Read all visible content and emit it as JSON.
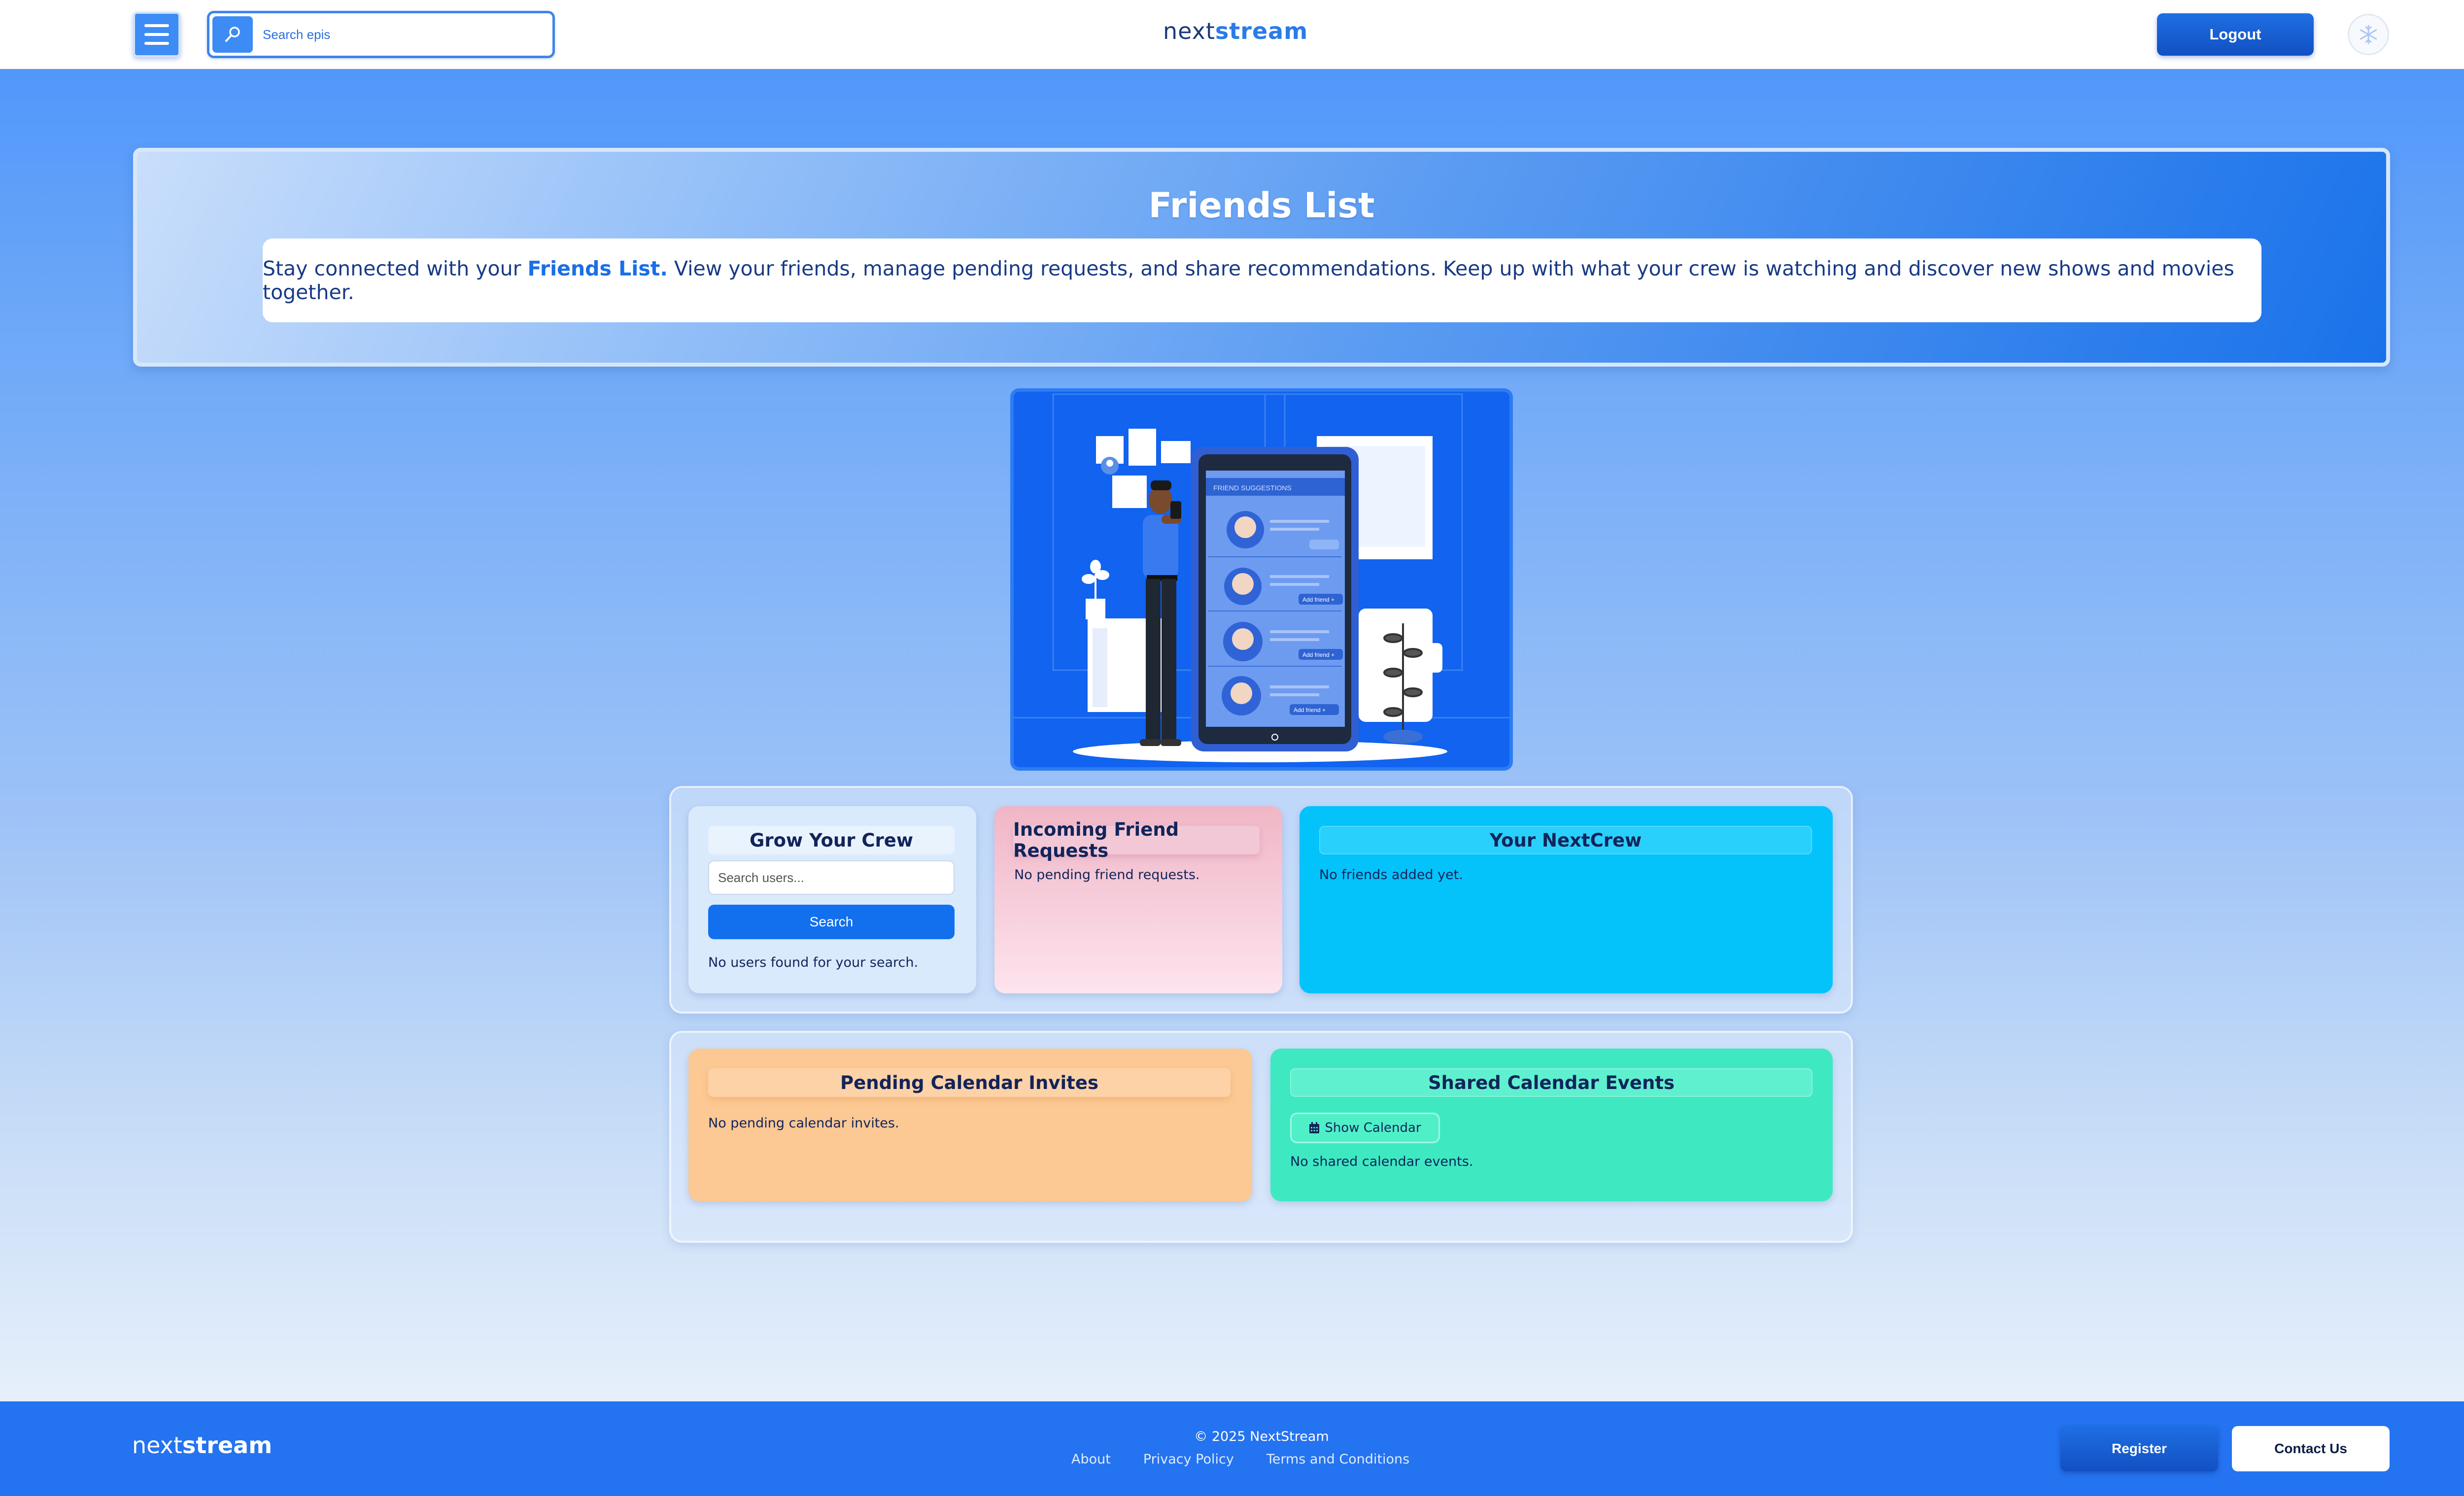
{
  "nav": {
    "search_placeholder": "Search epis",
    "brand_part1": "next",
    "brand_part2": "stream",
    "logout_label": "Logout"
  },
  "hero": {
    "title": "Friends List",
    "intro_before": "Stay connected with your ",
    "intro_highlight": "Friends List.",
    "intro_after": " View your friends, manage pending requests, and share recommendations. Keep up with what your crew is watching and discover new shows and movies together."
  },
  "illustration": {
    "phone_header": "FRIEND SUGGESTIONS",
    "add_friend_label": "Add friend +"
  },
  "grow": {
    "title": "Grow Your Crew",
    "search_placeholder": "Search users...",
    "search_button": "Search",
    "empty_text": "No users found for your search."
  },
  "incoming": {
    "title": "Incoming Friend Requests",
    "empty_text": "No pending friend requests."
  },
  "crew": {
    "title": "Your NextCrew",
    "empty_text": "No friends added yet."
  },
  "pending_cal": {
    "title": "Pending Calendar Invites",
    "empty_text": "No pending calendar invites."
  },
  "shared_cal": {
    "title": "Shared Calendar Events",
    "show_button": "Show Calendar",
    "empty_text": "No shared calendar events."
  },
  "footer": {
    "brand_part1": "next",
    "brand_part2": "stream",
    "copyright": "© 2025 NextStream",
    "links": [
      "About",
      "Privacy Policy",
      "Terms and Conditions"
    ],
    "register_label": "Register",
    "contact_label": "Contact Us"
  },
  "colors": {
    "accent": "#1270ee",
    "nav_bg": "#ffffff",
    "footer_bg": "#2473f0",
    "grow_card": "#d9eafc",
    "incoming_card": "#f0b6c6",
    "crew_card": "#04c3fb",
    "pending_card": "#fcc893",
    "shared_card": "#3ee9c2"
  },
  "icons": [
    "menu-icon",
    "search-icon",
    "snowflake-icon",
    "calendar-icon"
  ]
}
